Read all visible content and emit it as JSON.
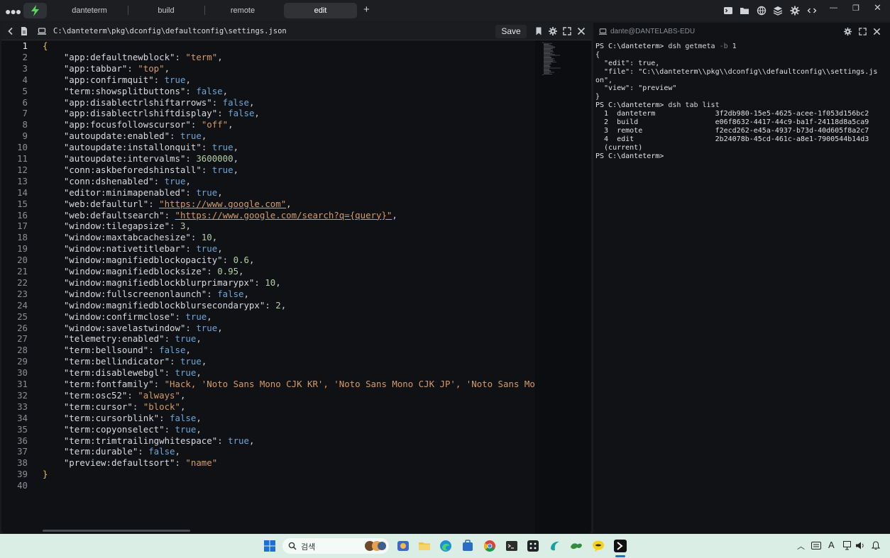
{
  "tabs": [
    {
      "label": "danteterm"
    },
    {
      "label": "build"
    },
    {
      "label": "remote"
    },
    {
      "label": "edit",
      "active": true
    }
  ],
  "editor": {
    "path": "C:\\danteterm\\pkg\\dconfig\\defaultconfig\\settings.json",
    "save_label": "Save",
    "current_line": 1,
    "lines": [
      {
        "n": "1",
        "t": "{"
      },
      {
        "n": "2",
        "k": "\"app:defaultnewblock\"",
        "v": "\"term\"",
        "vt": "s",
        "c": ","
      },
      {
        "n": "3",
        "k": "\"app:tabbar\"",
        "v": "\"top\"",
        "vt": "s",
        "c": ","
      },
      {
        "n": "4",
        "k": "\"app:confirmquit\"",
        "v": "true",
        "vt": "b",
        "c": ","
      },
      {
        "n": "5",
        "k": "\"term:showsplitbuttons\"",
        "v": "false",
        "vt": "b",
        "c": ","
      },
      {
        "n": "6",
        "k": "\"app:disablectrlshiftarrows\"",
        "v": "false",
        "vt": "b",
        "c": ","
      },
      {
        "n": "7",
        "k": "\"app:disablectrlshiftdisplay\"",
        "v": "false",
        "vt": "b",
        "c": ","
      },
      {
        "n": "8",
        "k": "\"app:focusfollowscursor\"",
        "v": "\"off\"",
        "vt": "s",
        "c": ","
      },
      {
        "n": "9",
        "k": "\"autoupdate:enabled\"",
        "v": "true",
        "vt": "b",
        "c": ","
      },
      {
        "n": "10",
        "k": "\"autoupdate:installonquit\"",
        "v": "true",
        "vt": "b",
        "c": ","
      },
      {
        "n": "11",
        "k": "\"autoupdate:intervalms\"",
        "v": "3600000",
        "vt": "n",
        "c": ","
      },
      {
        "n": "12",
        "k": "\"conn:askbeforedshinstall\"",
        "v": "true",
        "vt": "b",
        "c": ","
      },
      {
        "n": "13",
        "k": "\"conn:dshenabled\"",
        "v": "true",
        "vt": "b",
        "c": ","
      },
      {
        "n": "14",
        "k": "\"editor:minimapenabled\"",
        "v": "true",
        "vt": "b",
        "c": ","
      },
      {
        "n": "15",
        "k": "\"web:defaulturl\"",
        "v": "\"https://www.google.com\"",
        "vt": "u",
        "c": ","
      },
      {
        "n": "16",
        "k": "\"web:defaultsearch\"",
        "v": "\"https://www.google.com/search?q={query}\"",
        "vt": "u",
        "c": ","
      },
      {
        "n": "17",
        "k": "\"window:tilegapsize\"",
        "v": "3",
        "vt": "n",
        "c": ","
      },
      {
        "n": "18",
        "k": "\"window:maxtabcachesize\"",
        "v": "10",
        "vt": "n",
        "c": ","
      },
      {
        "n": "19",
        "k": "\"window:nativetitlebar\"",
        "v": "true",
        "vt": "b",
        "c": ","
      },
      {
        "n": "20",
        "k": "\"window:magnifiedblockopacity\"",
        "v": "0.6",
        "vt": "n",
        "c": ","
      },
      {
        "n": "21",
        "k": "\"window:magnifiedblocksize\"",
        "v": "0.95",
        "vt": "n",
        "c": ","
      },
      {
        "n": "22",
        "k": "\"window:magnifiedblockblurprimarypx\"",
        "v": "10",
        "vt": "n",
        "c": ","
      },
      {
        "n": "23",
        "k": "\"window:fullscreenonlaunch\"",
        "v": "false",
        "vt": "b",
        "c": ","
      },
      {
        "n": "24",
        "k": "\"window:magnifiedblockblursecondarypx\"",
        "v": "2",
        "vt": "n",
        "c": ","
      },
      {
        "n": "25",
        "k": "\"window:confirmclose\"",
        "v": "true",
        "vt": "b",
        "c": ","
      },
      {
        "n": "26",
        "k": "\"window:savelastwindow\"",
        "v": "true",
        "vt": "b",
        "c": ","
      },
      {
        "n": "27",
        "k": "\"telemetry:enabled\"",
        "v": "true",
        "vt": "b",
        "c": ","
      },
      {
        "n": "28",
        "k": "\"term:bellsound\"",
        "v": "false",
        "vt": "b",
        "c": ","
      },
      {
        "n": "29",
        "k": "\"term:bellindicator\"",
        "v": "true",
        "vt": "b",
        "c": ","
      },
      {
        "n": "30",
        "k": "\"term:disablewebgl\"",
        "v": "true",
        "vt": "b",
        "c": ","
      },
      {
        "n": "31",
        "k": "\"term:fontfamily\"",
        "v": "\"Hack, 'Noto Sans Mono CJK KR', 'Noto Sans Mono CJK JP', 'Noto Sans Mono CJK SC', 'Noto",
        "vt": "s",
        "c": ""
      },
      {
        "n": "32",
        "k": "\"term:osc52\"",
        "v": "\"always\"",
        "vt": "s",
        "c": ","
      },
      {
        "n": "33",
        "k": "\"term:cursor\"",
        "v": "\"block\"",
        "vt": "s",
        "c": ","
      },
      {
        "n": "34",
        "k": "\"term:cursorblink\"",
        "v": "false",
        "vt": "b",
        "c": ","
      },
      {
        "n": "35",
        "k": "\"term:copyonselect\"",
        "v": "true",
        "vt": "b",
        "c": ","
      },
      {
        "n": "36",
        "k": "\"term:trimtrailingwhitespace\"",
        "v": "true",
        "vt": "b",
        "c": ","
      },
      {
        "n": "37",
        "k": "\"term:durable\"",
        "v": "false",
        "vt": "b",
        "c": ","
      },
      {
        "n": "38",
        "k": "\"preview:defaultsort\"",
        "v": "\"name\"",
        "vt": "s",
        "c": ""
      },
      {
        "n": "39",
        "t": "}"
      },
      {
        "n": "40",
        "t": ""
      }
    ]
  },
  "terminal": {
    "connection": "dante@DANTELABS-EDU",
    "lines": [
      {
        "ps": "PS C:\\danteterm>",
        "cmd": " dsh getmeta",
        "flag": " -b",
        "rest": " 1"
      },
      {
        "text": "{"
      },
      {
        "text": "  \"edit\": true,"
      },
      {
        "text": "  \"file\": \"C:\\\\danteterm\\\\pkg\\\\dconfig\\\\defaultconfig\\\\settings.js"
      },
      {
        "text": "on\","
      },
      {
        "text": "  \"view\": \"preview\""
      },
      {
        "text": "}"
      },
      {
        "ps": "PS C:\\danteterm>",
        "cmd": " dsh tab list",
        "flag": "",
        "rest": ""
      },
      {
        "text": "  1  danteterm              3f2db980-15e5-4625-acee-1f053d156bc2"
      },
      {
        "text": "  2  build                  e06f8632-4417-44c9-ba1f-24118d8a5ca9"
      },
      {
        "text": "  3  remote                 f2ecd262-e45a-4937-b73d-40d605f8a2c7"
      },
      {
        "text": "  4  edit                   2b24078b-45cd-461c-a8e1-7900544b14d3"
      },
      {
        "text": "  (current)"
      },
      {
        "ps": "PS C:\\danteterm>",
        "cmd": "",
        "flag": "",
        "rest": ""
      }
    ]
  },
  "taskbar": {
    "search_label": "검색"
  },
  "colors": {
    "accent_green": "#57d957",
    "string": "#d49b6b",
    "number": "#b5cea8",
    "boolean": "#6ea6d8",
    "bracket": "#e2c541"
  }
}
